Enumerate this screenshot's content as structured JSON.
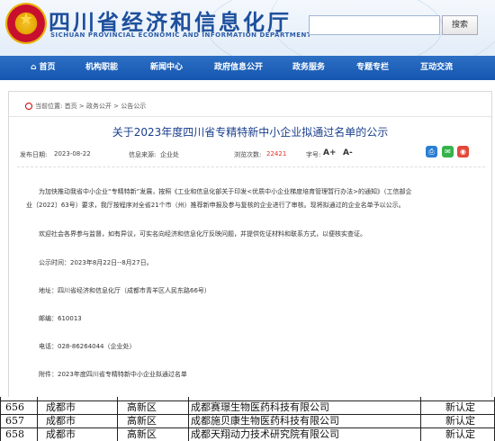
{
  "header": {
    "site_title": "四川省经济和信息化厅",
    "site_subtitle": "SICHUAN PROVINCIAL ECONOMIC AND INFORMATION DEPARTMENT",
    "search_placeholder": "",
    "search_button": "搜索"
  },
  "nav": {
    "items": [
      "首页",
      "机构职能",
      "新闻中心",
      "政府信息公开",
      "政务服务",
      "专题专栏",
      "互动交流"
    ]
  },
  "breadcrumb": "当前位置: 首页 > 政务公开 > 公告公示",
  "article": {
    "title": "关于2023年度四川省专精特新中小企业拟通过名单的公示",
    "publish_label": "发布日期:",
    "publish_date": "2023-08-22",
    "source_label": "信息来源:",
    "source": "企业处",
    "views_label": "浏览次数:",
    "views": "22421",
    "font_label": "字号:",
    "font_increase": "A+",
    "font_decrease": "A-",
    "para1_line1": "为加快推动我省中小企业“专精特新”发展，按照《工业和信息化部关于印发<优质中小企业梯度培育管理暂行办法>的通知》（工信部企",
    "para1_line2": "业〔2022〕63号）要求，我厅按程序对全省21个市（州）推荐新申报及参与复核的企业进行了审核。现将拟通过的企业名单予以公示。",
    "para2": "欢迎社会各界参与监督，如有异议，可实名向经济和信息化厅反映问题，并提供佐证材料和联系方式，以便核实查证。",
    "period": "公示时间：2023年8月22日--8月27日。",
    "address": "地址：四川省经济和信息化厅（成都市青羊区人民东路66号）",
    "postcode": "邮编：610013",
    "phone": "电话：028-86264044（企业处）",
    "attachment": "附件：2023年度四川省专精特新中小企业拟通过名单"
  },
  "table": {
    "rows": [
      {
        "no": "656",
        "city": "成都市",
        "district": "高新区",
        "company": "成都赛璟生物医药科技有限公司",
        "type": "新认定"
      },
      {
        "no": "657",
        "city": "成都市",
        "district": "高新区",
        "company": "成都施贝康生物医药科技有限公司",
        "type": "新认定"
      },
      {
        "no": "658",
        "city": "成都市",
        "district": "高新区",
        "company": "成都天翔动力技术研究院有限公司",
        "type": "新认定"
      }
    ]
  },
  "colors": {
    "brand_blue": "#1d4f9c",
    "nav_blue": "#1557b0",
    "views_red": "#e0302a",
    "wechat_green": "#35b34a",
    "weibo_red": "#e2483a"
  }
}
